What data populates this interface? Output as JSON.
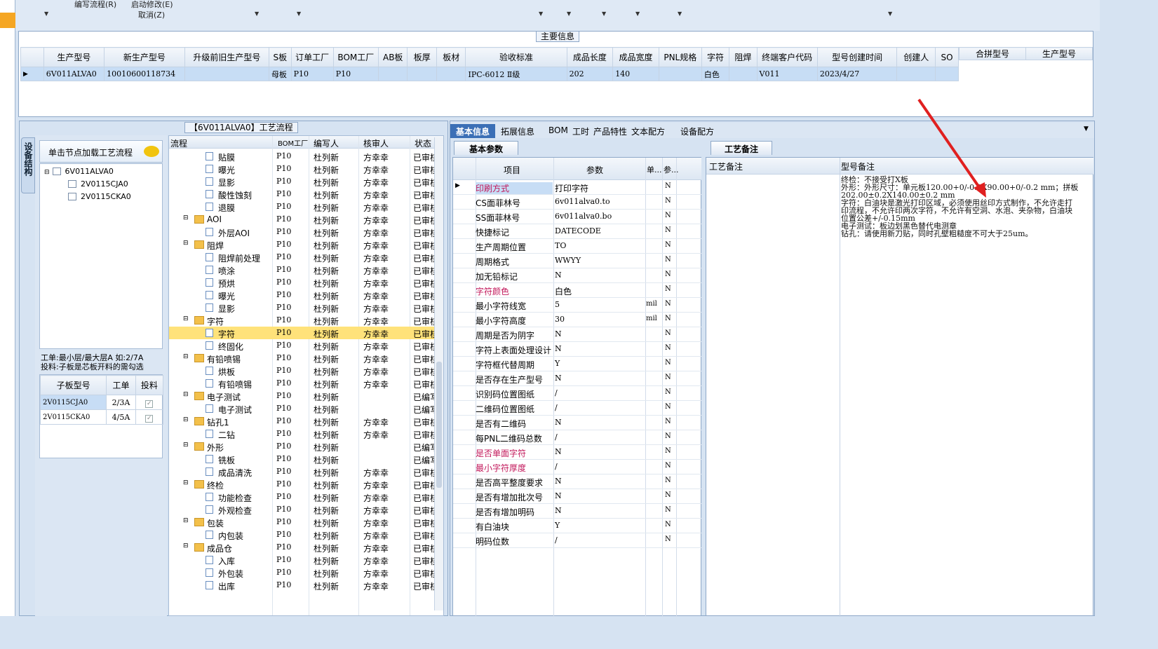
{
  "menu": {
    "edit_flow": "编写流程(R)",
    "start_modify": "启动修改(E)",
    "cancel": "取消(Z)"
  },
  "main_info": {
    "title": "主要信息",
    "columns": [
      "生产型号",
      "新生产型号",
      "升级前旧生产型号",
      "S板",
      "订单工厂",
      "BOM工厂",
      "AB板",
      "板厚",
      "板材",
      "验收标准",
      "成品长度",
      "成品宽度",
      "PNL规格",
      "字符",
      "阻焊",
      "终端客户代码",
      "型号创建时间",
      "创建人",
      "SO"
    ],
    "row": [
      "6V011ALVA0",
      "10010600118734",
      "",
      "母板",
      "P10",
      "P10",
      "",
      "",
      "",
      "IPC-6012 Ⅱ级",
      "202",
      "140",
      "",
      "白色",
      "",
      "V011",
      "2023/4/27",
      "",
      ""
    ],
    "merge_columns": [
      "合拼型号",
      "生产型号"
    ]
  },
  "process": {
    "title": "【6V011ALVA0】工艺流程",
    "side_tab": "设备结构",
    "load_button": "单击节点加载工艺流程",
    "tree": {
      "root": "6V011ALVA0",
      "children": [
        "2V0115CJA0",
        "2V0115CKA0"
      ]
    },
    "note_line1": "工单:最小层/最大层A 如:2/7A",
    "note_line2": "投料:子板是芯板开料的需勾选",
    "sub_columns": [
      "子板型号",
      "工单",
      "投料"
    ],
    "sub_rows": [
      {
        "model": "2V0115CJA0",
        "order": "2/3A"
      },
      {
        "model": "2V0115CKA0",
        "order": "4/5A"
      }
    ],
    "flow_columns": [
      "流程",
      "BOM工厂",
      "编写人",
      "核审人",
      "状态"
    ],
    "flow_rows": [
      {
        "name": "贴膜",
        "lvl": 2,
        "f": "P10",
        "w": "杜列新",
        "r": "方幸幸",
        "s": "已审核"
      },
      {
        "name": "曝光",
        "lvl": 2,
        "f": "P10",
        "w": "杜列新",
        "r": "方幸幸",
        "s": "已审核"
      },
      {
        "name": "显影",
        "lvl": 2,
        "f": "P10",
        "w": "杜列新",
        "r": "方幸幸",
        "s": "已审核"
      },
      {
        "name": "酸性蚀刻",
        "lvl": 2,
        "f": "P10",
        "w": "杜列新",
        "r": "方幸幸",
        "s": "已审核"
      },
      {
        "name": "退膜",
        "lvl": 2,
        "f": "P10",
        "w": "杜列新",
        "r": "方幸幸",
        "s": "已审核"
      },
      {
        "name": "AOI",
        "lvl": 1,
        "f": "P10",
        "w": "杜列新",
        "r": "方幸幸",
        "s": "已审核"
      },
      {
        "name": "外层AOI",
        "lvl": 2,
        "f": "P10",
        "w": "杜列新",
        "r": "方幸幸",
        "s": "已审核"
      },
      {
        "name": "阻焊",
        "lvl": 1,
        "f": "P10",
        "w": "杜列新",
        "r": "方幸幸",
        "s": "已审核"
      },
      {
        "name": "阻焊前处理",
        "lvl": 2,
        "f": "P10",
        "w": "杜列新",
        "r": "方幸幸",
        "s": "已审核"
      },
      {
        "name": "喷涂",
        "lvl": 2,
        "f": "P10",
        "w": "杜列新",
        "r": "方幸幸",
        "s": "已审核"
      },
      {
        "name": "预烘",
        "lvl": 2,
        "f": "P10",
        "w": "杜列新",
        "r": "方幸幸",
        "s": "已审核"
      },
      {
        "name": "曝光",
        "lvl": 2,
        "f": "P10",
        "w": "杜列新",
        "r": "方幸幸",
        "s": "已审核"
      },
      {
        "name": "显影",
        "lvl": 2,
        "f": "P10",
        "w": "杜列新",
        "r": "方幸幸",
        "s": "已审核"
      },
      {
        "name": "字符",
        "lvl": 1,
        "f": "P10",
        "w": "杜列新",
        "r": "方幸幸",
        "s": "已审核"
      },
      {
        "name": "字符",
        "lvl": 2,
        "f": "P10",
        "w": "杜列新",
        "r": "方幸幸",
        "s": "已审核",
        "sel": true
      },
      {
        "name": "终固化",
        "lvl": 2,
        "f": "P10",
        "w": "杜列新",
        "r": "方幸幸",
        "s": "已审核"
      },
      {
        "name": "有铅喷锡",
        "lvl": 1,
        "f": "P10",
        "w": "杜列新",
        "r": "方幸幸",
        "s": "已审核"
      },
      {
        "name": "烘板",
        "lvl": 2,
        "f": "P10",
        "w": "杜列新",
        "r": "方幸幸",
        "s": "已审核"
      },
      {
        "name": "有铅喷锡",
        "lvl": 2,
        "f": "P10",
        "w": "杜列新",
        "r": "方幸幸",
        "s": "已审核"
      },
      {
        "name": "电子测试",
        "lvl": 1,
        "f": "P10",
        "w": "杜列新",
        "r": "",
        "s": "已编写"
      },
      {
        "name": "电子测试",
        "lvl": 2,
        "f": "P10",
        "w": "杜列新",
        "r": "",
        "s": "已编写"
      },
      {
        "name": "钻孔1",
        "lvl": 1,
        "f": "P10",
        "w": "杜列新",
        "r": "方幸幸",
        "s": "已审核"
      },
      {
        "name": "二钻",
        "lvl": 2,
        "f": "P10",
        "w": "杜列新",
        "r": "方幸幸",
        "s": "已审核"
      },
      {
        "name": "外形",
        "lvl": 1,
        "f": "P10",
        "w": "杜列新",
        "r": "",
        "s": "已编写"
      },
      {
        "name": "铣板",
        "lvl": 2,
        "f": "P10",
        "w": "杜列新",
        "r": "",
        "s": "已编写"
      },
      {
        "name": "成品清洗",
        "lvl": 2,
        "f": "P10",
        "w": "杜列新",
        "r": "方幸幸",
        "s": "已审核"
      },
      {
        "name": "终检",
        "lvl": 1,
        "f": "P10",
        "w": "杜列新",
        "r": "方幸幸",
        "s": "已审核"
      },
      {
        "name": "功能检查",
        "lvl": 2,
        "f": "P10",
        "w": "杜列新",
        "r": "方幸幸",
        "s": "已审核"
      },
      {
        "name": "外观检查",
        "lvl": 2,
        "f": "P10",
        "w": "杜列新",
        "r": "方幸幸",
        "s": "已审核"
      },
      {
        "name": "包装",
        "lvl": 1,
        "f": "P10",
        "w": "杜列新",
        "r": "方幸幸",
        "s": "已审核"
      },
      {
        "name": "内包装",
        "lvl": 2,
        "f": "P10",
        "w": "杜列新",
        "r": "方幸幸",
        "s": "已审核"
      },
      {
        "name": "成品仓",
        "lvl": 1,
        "f": "P10",
        "w": "杜列新",
        "r": "方幸幸",
        "s": "已审核"
      },
      {
        "name": "入库",
        "lvl": 2,
        "f": "P10",
        "w": "杜列新",
        "r": "方幸幸",
        "s": "已审核"
      },
      {
        "name": "外包装",
        "lvl": 2,
        "f": "P10",
        "w": "杜列新",
        "r": "方幸幸",
        "s": "已审核"
      },
      {
        "name": "出库",
        "lvl": 2,
        "f": "P10",
        "w": "杜列新",
        "r": "方幸幸",
        "s": "已审核"
      }
    ]
  },
  "tabs": [
    "基本信息",
    "拓展信息",
    "BOM",
    "工时",
    "产品特性",
    "文本配方",
    "设备配方"
  ],
  "params": {
    "title": "基本参数",
    "columns": [
      "项目",
      "参数",
      "单...",
      "参..."
    ],
    "rows": [
      {
        "k": "印刷方式",
        "v": "打印字符",
        "u": "",
        "n": "N",
        "pink": true
      },
      {
        "k": "CS面菲林号",
        "v": "6v011alva0.to",
        "u": "",
        "n": "N"
      },
      {
        "k": "SS面菲林号",
        "v": "6v011alva0.bo",
        "u": "",
        "n": "N"
      },
      {
        "k": "快捷标记",
        "v": "DATECODE",
        "u": "",
        "n": "N"
      },
      {
        "k": "生产周期位置",
        "v": "TO",
        "u": "",
        "n": "N"
      },
      {
        "k": "周期格式",
        "v": "WWYY",
        "u": "",
        "n": "N"
      },
      {
        "k": "加无铅标记",
        "v": "N",
        "u": "",
        "n": "N"
      },
      {
        "k": "字符颜色",
        "v": "白色",
        "u": "",
        "n": "N",
        "pink": true
      },
      {
        "k": "最小字符线宽",
        "v": "5",
        "u": "mil",
        "n": "N"
      },
      {
        "k": "最小字符高度",
        "v": "30",
        "u": "mil",
        "n": "N"
      },
      {
        "k": "周期是否为阴字",
        "v": "N",
        "u": "",
        "n": "N"
      },
      {
        "k": "字符上表面处理设计",
        "v": "N",
        "u": "",
        "n": "N"
      },
      {
        "k": "字符框代替周期",
        "v": "Y",
        "u": "",
        "n": "N"
      },
      {
        "k": "是否存在生产型号",
        "v": "N",
        "u": "",
        "n": "N"
      },
      {
        "k": "识别码位置图纸",
        "v": "/",
        "u": "",
        "n": "N"
      },
      {
        "k": "二维码位置图纸",
        "v": "/",
        "u": "",
        "n": "N"
      },
      {
        "k": "是否有二维码",
        "v": "N",
        "u": "",
        "n": "N"
      },
      {
        "k": "每PNL二维码总数",
        "v": "/",
        "u": "",
        "n": "N"
      },
      {
        "k": "是否单面字符",
        "v": "N",
        "u": "",
        "n": "N",
        "pink": true
      },
      {
        "k": "最小字符厚度",
        "v": "/",
        "u": "",
        "n": "N",
        "pink": true
      },
      {
        "k": "是否高平整度要求",
        "v": "N",
        "u": "",
        "n": "N"
      },
      {
        "k": "是否有增加批次号",
        "v": "N",
        "u": "",
        "n": "N"
      },
      {
        "k": "是否有增加明码",
        "v": "N",
        "u": "",
        "n": "N"
      },
      {
        "k": "有白油块",
        "v": "Y",
        "u": "",
        "n": "N"
      },
      {
        "k": "明码位数",
        "v": "/",
        "u": "",
        "n": "N"
      }
    ]
  },
  "remarks": {
    "title": "工艺备注",
    "col1": "工艺备注",
    "col2": "型号备注",
    "lines": [
      "终检：不接受打X板",
      "外形：外形尺寸：单元板120.00+0/-0.2X90.00+0/-0.2 mm；拼板",
      "202.00±0.2X140.00±0.2 mm",
      "字符：白油块是激光打印区域，必须使用丝印方式制作，不允许走打",
      "印流程，不允许印两次字符，不允许有空洞、水泡、夹杂物，白油块",
      "位置公差+/-0.15mm",
      "电子测试：板边划黑色替代电测章",
      "钻孔：请使用新刀贴，同时孔壁粗糙度不可大于25um。"
    ]
  },
  "colors": {
    "accent": "#3b6fb6",
    "selected_row": "#ffe27a",
    "arrow": "#e02020"
  }
}
